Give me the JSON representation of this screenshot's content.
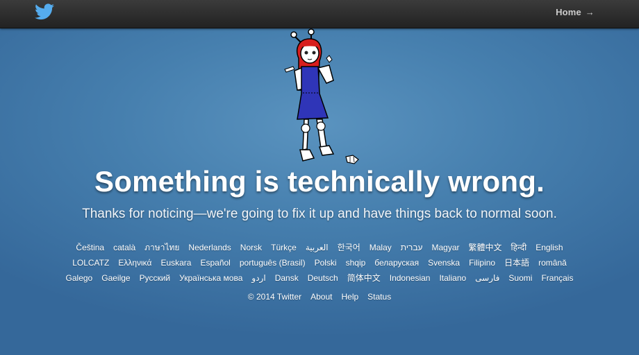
{
  "header": {
    "logo_icon": "twitter-bird-icon",
    "home_label": "Home",
    "home_arrow": "→"
  },
  "illustration": {
    "icon": "robot-girl-illustration"
  },
  "error": {
    "headline": "Something is technically wrong.",
    "message": "Thanks for noticing—we're going to fix it up and have things back to normal soon."
  },
  "languages": [
    [
      "Čeština",
      "català",
      "ภาษาไทย",
      "Nederlands",
      "Norsk",
      "Türkçe",
      "العربية",
      "한국어",
      "Malay",
      "עברית",
      "Magyar",
      "繁體中文",
      "हिन्दी",
      "English"
    ],
    [
      "LOLCATZ",
      "Ελληνικά",
      "Euskara",
      "Español",
      "português (Brasil)",
      "Polski",
      "shqip",
      "беларуская",
      "Svenska",
      "Filipino",
      "日本語",
      "română"
    ],
    [
      "Galego",
      "Gaeilge",
      "Русский",
      "Українська мова",
      "اردو",
      "Dansk",
      "Deutsch",
      "简体中文",
      "Indonesian",
      "Italiano",
      "فارسی",
      "Suomi",
      "Français"
    ]
  ],
  "footer": {
    "copyright": "© 2014 Twitter",
    "links": [
      "About",
      "Help",
      "Status"
    ]
  },
  "colors": {
    "twitter_blue": "#55acee",
    "background": "#467fae"
  }
}
